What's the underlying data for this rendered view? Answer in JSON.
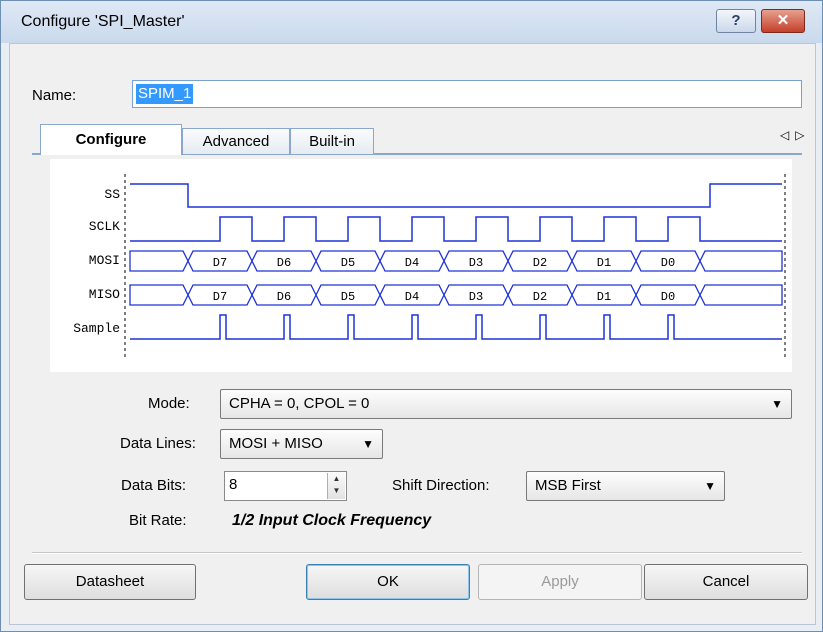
{
  "window": {
    "title": "Configure 'SPI_Master'",
    "help_label": "?",
    "close_label": "✕"
  },
  "name_field": {
    "label": "Name:",
    "value": "SPIM_1"
  },
  "tabs": [
    {
      "label": "Configure"
    },
    {
      "label": "Advanced"
    },
    {
      "label": "Built-in"
    }
  ],
  "tab_scroll": {
    "left": "◁",
    "right": "▷"
  },
  "timing_diagram": {
    "signals": [
      "SS",
      "SCLK",
      "MOSI",
      "MISO",
      "Sample"
    ],
    "bits": [
      "D7",
      "D6",
      "D5",
      "D4",
      "D3",
      "D2",
      "D1",
      "D0"
    ],
    "line_color": "#1f33d8"
  },
  "mode": {
    "label": "Mode:",
    "value": "CPHA = 0, CPOL = 0"
  },
  "data_lines": {
    "label": "Data Lines:",
    "value": "MOSI + MISO"
  },
  "data_bits": {
    "label": "Data Bits:",
    "value": "8"
  },
  "shift_direction": {
    "label": "Shift Direction:",
    "value": "MSB First"
  },
  "bit_rate": {
    "label": "Bit Rate:",
    "value": "1/2 Input Clock Frequency"
  },
  "buttons": {
    "datasheet": "Datasheet",
    "ok": "OK",
    "apply": "Apply",
    "cancel": "Cancel"
  }
}
